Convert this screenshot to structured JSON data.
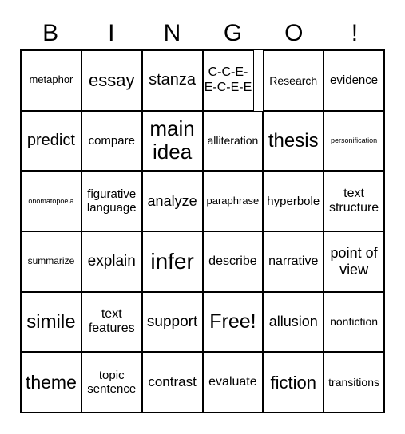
{
  "header": {
    "letters": [
      "B",
      "I",
      "N",
      "G",
      "O",
      "!"
    ]
  },
  "cells": [
    [
      "metaphor",
      "essay",
      "stanza",
      "C-C-E-E-C-E-E",
      "Research",
      "evidence"
    ],
    [
      "predict",
      "compare",
      "main idea",
      "alliteration",
      "thesis",
      "personification"
    ],
    [
      "onomatopoeia",
      "figurative language",
      "analyze",
      "paraphrase",
      "hyperbole",
      "text structure"
    ],
    [
      "summarize",
      "explain",
      "infer",
      "describe",
      "narrative",
      "point of view"
    ],
    [
      "simile",
      "text features",
      "support",
      "Free!",
      "allusion",
      "nonfiction"
    ],
    [
      "theme",
      "topic sentence",
      "contrast",
      "evaluate",
      "fiction",
      "transitions"
    ]
  ]
}
